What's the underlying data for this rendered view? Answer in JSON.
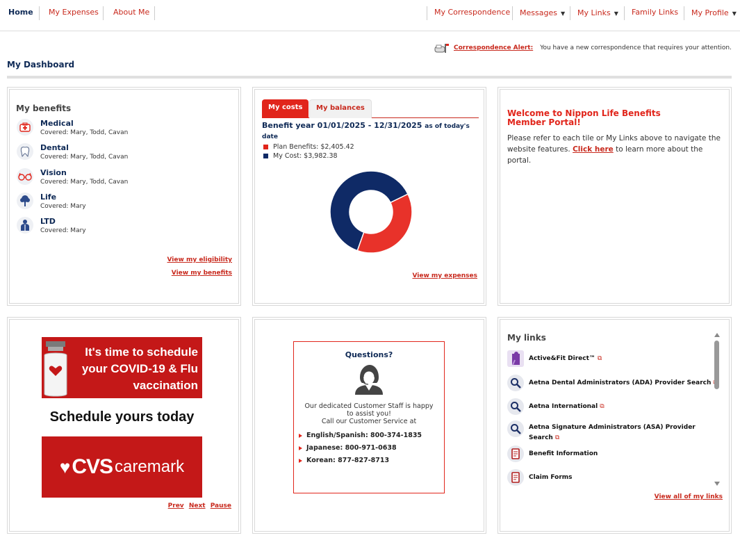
{
  "nav": {
    "home": "Home",
    "expenses": "My Expenses",
    "about": "About Me",
    "correspondence": "My Correspondence",
    "messages": "Messages",
    "links": "My Links",
    "family": "Family Links",
    "profile": "My Profile"
  },
  "alert": {
    "link": "Correspondence Alert:",
    "text": "You have a new correspondence that requires your attention."
  },
  "dashboard_title": "My Dashboard",
  "benefits": {
    "title": "My benefits",
    "items": [
      {
        "name": "Medical",
        "covered": "Covered: Mary, Todd, Cavan"
      },
      {
        "name": "Dental",
        "covered": "Covered: Mary, Todd, Cavan"
      },
      {
        "name": "Vision",
        "covered": "Covered: Mary, Todd, Cavan"
      },
      {
        "name": "Life",
        "covered": "Covered: Mary"
      },
      {
        "name": "LTD",
        "covered": "Covered: Mary"
      }
    ],
    "eligibility_link": "View my eligibility",
    "benefits_link": "View my benefits"
  },
  "costs": {
    "tab_costs": "My costs",
    "tab_balances": "My balances",
    "year_title": "Benefit year 01/01/2025 - 12/31/2025",
    "year_suffix": "as of today's date",
    "legend_plan": "Plan Benefits: $2,405.42",
    "legend_cost": "My Cost: $3,982.38",
    "expenses_link": "View my expenses",
    "colors": {
      "plan": "#e8322a",
      "cost": "#0f2a66"
    }
  },
  "chart_data": {
    "type": "pie",
    "categories": [
      "Plan Benefits",
      "My Cost"
    ],
    "values": [
      2405.42,
      3982.38
    ],
    "donut": true
  },
  "welcome": {
    "title": "Welcome to Nippon Life Benefits Member Portal!",
    "text_before": "Please refer to each tile or My Links above to navigate the website features.",
    "click_here": "Click here",
    "text_after": "to learn more about the portal."
  },
  "ad": {
    "line1": "It's time to schedule",
    "line2": "your COVID-19 & Flu",
    "line3": "vaccination",
    "cta": "Schedule yours today",
    "brand_a": "CVS",
    "brand_b": "caremark",
    "prev": "Prev",
    "next": "Next",
    "pause": "Pause"
  },
  "questions": {
    "title": "Questions?",
    "text1": "Our dedicated Customer Staff is happy to assist you!",
    "text2": "Call our Customer Service at",
    "english": "English/Spanish: 800-374-1835",
    "japanese": "Japanese: 800-971-0638",
    "korean": "Korean: 877-827-8713"
  },
  "links": {
    "title": "My links",
    "items": [
      {
        "label": "Active&Fit Direct™",
        "icon": "activefit-icon"
      },
      {
        "label": "Aetna Dental Administrators (ADA) Provider Search",
        "icon": "search-icon"
      },
      {
        "label": "Aetna International",
        "icon": "search-icon"
      },
      {
        "label": "Aetna Signature Administrators (ASA) Provider Search",
        "icon": "search-icon"
      },
      {
        "label": "Benefit Information",
        "icon": "document-icon"
      },
      {
        "label": "Claim Forms",
        "icon": "document-icon"
      }
    ],
    "view_all": "View all of my links"
  }
}
